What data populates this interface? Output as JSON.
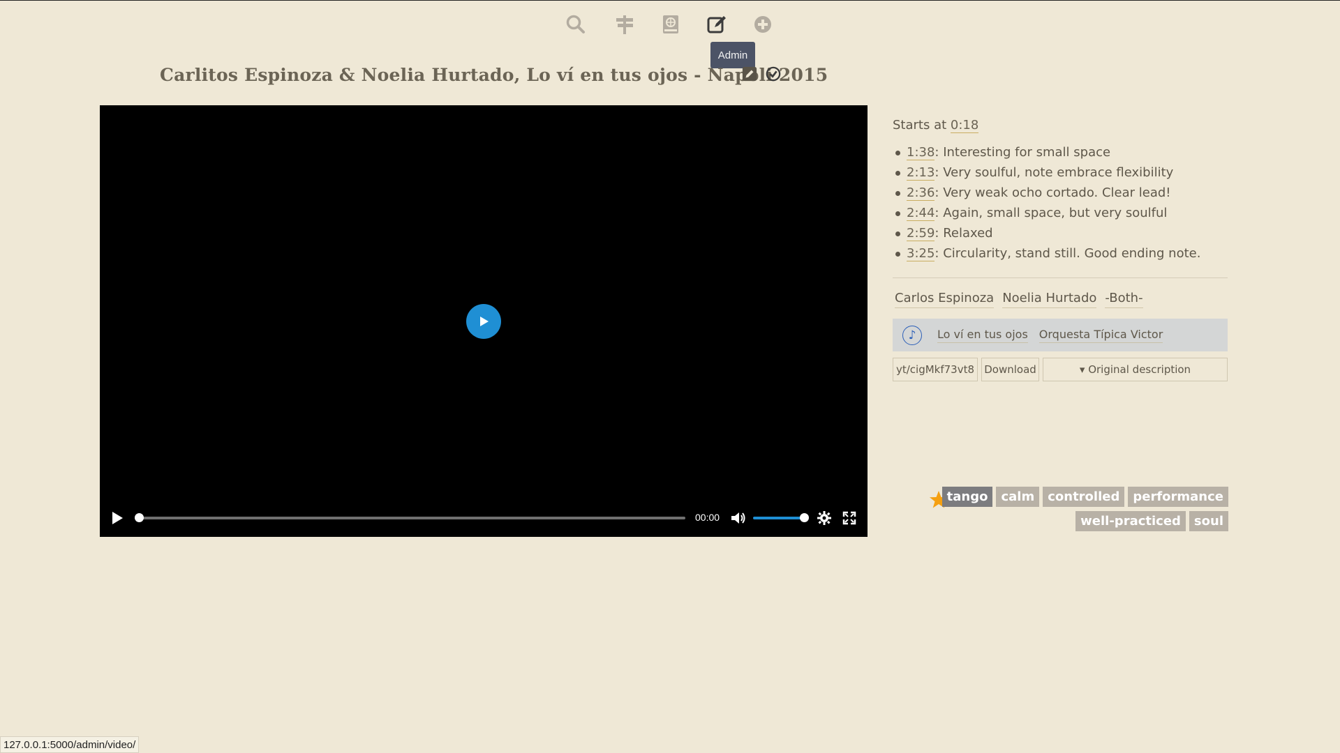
{
  "nav": {
    "items": [
      {
        "name": "search-icon"
      },
      {
        "name": "signpost-icon"
      },
      {
        "name": "book-globe-icon"
      },
      {
        "name": "edit-icon",
        "tooltip": "Admin"
      },
      {
        "name": "plus-circle-icon"
      }
    ],
    "tooltip": "Admin"
  },
  "video": {
    "title": "Carlitos Espinoza & Noelia Hurtado, Lo ví en tus ojos - Napoli 2015",
    "time": "00:00",
    "progress": 0,
    "volume": 1.0
  },
  "side": {
    "starts_label": "Starts at ",
    "starts_time": "0:18",
    "notes": [
      {
        "time": "1:38",
        "text": ": Interesting for small space"
      },
      {
        "time": "2:13",
        "text": ": Very soulful, note embrace flexibility"
      },
      {
        "time": "2:36",
        "text": ": Very weak ocho cortado. Clear lead!"
      },
      {
        "time": "2:44",
        "text": ": Again, small space, but very soulful"
      },
      {
        "time": "2:59",
        "text": ": Relaxed"
      },
      {
        "time": "3:25",
        "text": ": Circularity, stand still. Good ending note."
      }
    ],
    "people": [
      "Carlos Espinoza",
      "Noelia Hurtado",
      "-Both-"
    ],
    "music": {
      "song": "Lo ví en tus ojos",
      "orchestra": "Orquesta Típica Victor"
    },
    "buttons": {
      "yt": "yt/cigMkf73vt8",
      "download": "Download",
      "description": "▾ Original description"
    }
  },
  "tags": {
    "row1": [
      "tango",
      "calm",
      "controlled",
      "performance"
    ],
    "row2": [
      "well-practiced",
      "soul"
    ],
    "star_color": "#f5a011"
  },
  "status": {
    "url": "127.0.0.1:5000/admin/video/"
  },
  "colors": {
    "accent_blue": "#1f8fd4",
    "background": "#efe8d6",
    "tag_active": "#7c7c7f",
    "tag_default": "#b8b1a6"
  }
}
